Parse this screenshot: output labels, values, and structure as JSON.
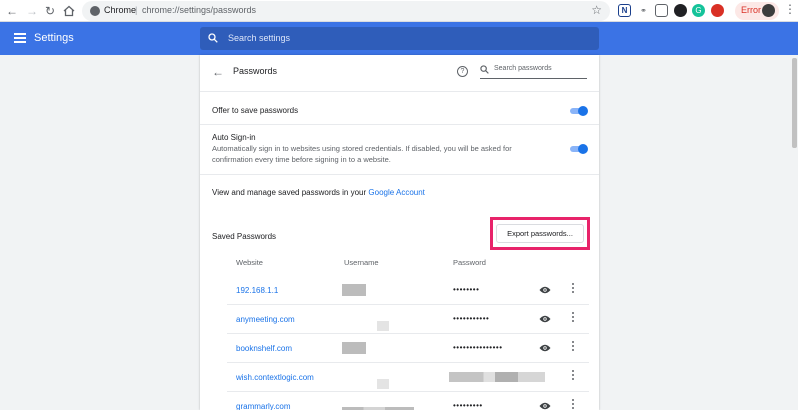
{
  "browser": {
    "chrome_label": "Chrome",
    "separator": "|",
    "url": "chrome://settings/passwords",
    "error_label": "Error",
    "ext_n": "N"
  },
  "header": {
    "title": "Settings",
    "search_placeholder": "Search settings"
  },
  "passwords": {
    "title": "Passwords",
    "search_placeholder": "Search passwords",
    "offer_label": "Offer to save passwords",
    "offer_enabled": true,
    "autosignin_label": "Auto Sign-in",
    "autosignin_desc": "Automatically sign in to websites using stored credentials. If disabled, you will be asked for confirmation every time before signing in to a website.",
    "autosignin_enabled": true,
    "manage_text": "View and manage saved passwords in your",
    "manage_link": "Google Account",
    "saved_heading": "Saved Passwords",
    "export_label": "Export passwords...",
    "columns": {
      "website": "Website",
      "username": "Username",
      "password": "Password"
    },
    "rows": [
      {
        "site": "192.168.1.1",
        "password": "••••••••"
      },
      {
        "site": "anymeeting.com",
        "password": "•••••••••••"
      },
      {
        "site": "booknshelf.com",
        "password": "•••••••••••••••"
      },
      {
        "site": "wish.contextlogic.com",
        "password": ""
      },
      {
        "site": "grammarly.com",
        "password": "•••••••••"
      }
    ]
  },
  "colors": {
    "header_blue": "#3b73e5",
    "link_blue": "#1a73e8",
    "highlight": "#e8236a"
  }
}
